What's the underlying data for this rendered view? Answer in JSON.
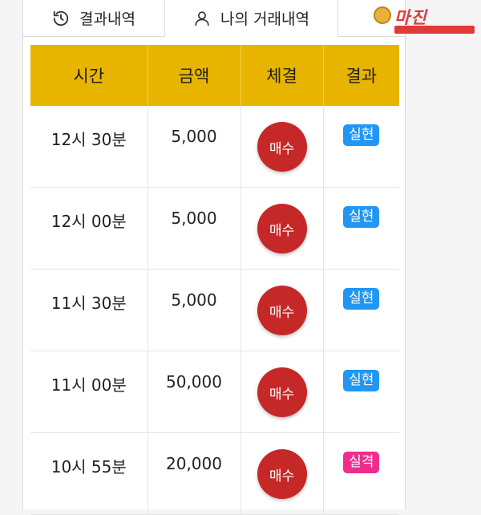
{
  "tabs": [
    {
      "label": "결과내역",
      "icon": "history-icon"
    },
    {
      "label": "나의 거래내역",
      "icon": "user-icon"
    }
  ],
  "watermark": {
    "text": "마진",
    "colors": {
      "brand": "#e23a3a"
    }
  },
  "table": {
    "headers": [
      "시간",
      "금액",
      "체결",
      "결과"
    ],
    "rows": [
      {
        "time": "12시 30분",
        "amount": "5,000",
        "trade": "매수",
        "result": "실현",
        "result_color": "#2196f3"
      },
      {
        "time": "12시 00분",
        "amount": "5,000",
        "trade": "매수",
        "result": "실현",
        "result_color": "#2196f3"
      },
      {
        "time": "11시 30분",
        "amount": "5,000",
        "trade": "매수",
        "result": "실현",
        "result_color": "#2196f3"
      },
      {
        "time": "11시 00분",
        "amount": "50,000",
        "trade": "매수",
        "result": "실현",
        "result_color": "#2196f3"
      },
      {
        "time": "10시 55분",
        "amount": "20,000",
        "trade": "매수",
        "result": "실격",
        "result_color": "#ee2d8c"
      }
    ]
  },
  "colors": {
    "header_bg": "#e7b400",
    "buy_button": "#c62828"
  }
}
